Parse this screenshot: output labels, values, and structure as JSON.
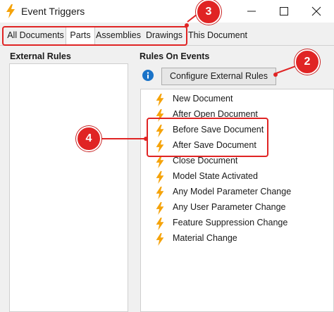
{
  "window": {
    "title": "Event Triggers",
    "controls": {
      "minimize": "minimize",
      "maximize": "maximize",
      "close": "close"
    }
  },
  "tabs": [
    {
      "label": "All Documents",
      "selected": false
    },
    {
      "label": "Parts",
      "selected": true
    },
    {
      "label": "Assemblies",
      "selected": false
    },
    {
      "label": "Drawings",
      "selected": false
    },
    {
      "label": "This Document",
      "selected": false
    }
  ],
  "external_rules": {
    "heading": "External Rules"
  },
  "rules_on_events": {
    "heading": "Rules On Events",
    "configure_button": "Configure External Rules",
    "events": [
      "New Document",
      "After Open Document",
      "Before Save Document",
      "After Save Document",
      "Close Document",
      "Model State Activated",
      "Any Model Parameter Change",
      "Any User Parameter Change",
      "Feature Suppression Change",
      "Material Change"
    ]
  },
  "callouts": [
    "3",
    "2",
    "4"
  ],
  "colors": {
    "accent_red": "#e02424",
    "lightning": "#f5a30a",
    "info_blue": "#1a73c8"
  },
  "icons": {
    "app": "lightning-icon",
    "event": "lightning-icon",
    "info": "info-icon"
  }
}
